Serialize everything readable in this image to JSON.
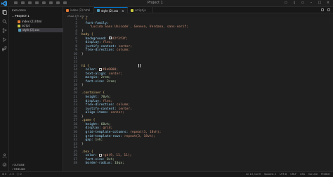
{
  "window": {
    "title": "Project 1"
  },
  "menu_count": 8,
  "sidebar": {
    "header": "EXPLORER",
    "project_label": "PROJECT 1",
    "files": [
      {
        "name": "index (2).html",
        "color": "#e37933"
      },
      {
        "name": "script",
        "color": "#cbcb41"
      },
      {
        "name": "style (2).css",
        "color": "#519aba"
      }
    ],
    "outline_label": "OUTLINE",
    "timeline_label": "TIMELINE"
  },
  "tabs": [
    {
      "label": "index (2).html",
      "color": "#e37933"
    },
    {
      "label": "style (2).css",
      "color": "#519aba",
      "active": true
    },
    {
      "label": "script.js",
      "color": "#cbcb41"
    }
  ],
  "breadcrumb": "style (2).css > ...",
  "code_lines": [
    {
      "n": "1",
      "parts": [
        {
          "t": "* {",
          "c": "sel"
        }
      ]
    },
    {
      "n": "2",
      "parts": [
        {
          "t": "  font-family: ",
          "c": "prop"
        }
      ]
    },
    {
      "n": "3",
      "parts": [
        {
          "t": "    'Lucida Sans Unicode', Geneva, Verdana, sans-serif;",
          "c": "val"
        }
      ]
    },
    {
      "n": "4",
      "parts": [
        {
          "t": "}",
          "c": "punc"
        }
      ]
    },
    {
      "n": "5",
      "parts": [
        {
          "t": "body {",
          "c": "sel"
        }
      ]
    },
    {
      "n": "6",
      "parts": [
        {
          "t": "  background: ",
          "c": "prop"
        },
        {
          "t": "#2f3f3f;",
          "c": "val",
          "swatch": "#2f3f3f"
        }
      ]
    },
    {
      "n": "7",
      "parts": [
        {
          "t": "  display: ",
          "c": "prop"
        },
        {
          "t": "flex;",
          "c": "val"
        }
      ]
    },
    {
      "n": "8",
      "parts": [
        {
          "t": "  justify-content: ",
          "c": "prop"
        },
        {
          "t": "center;",
          "c": "val"
        }
      ]
    },
    {
      "n": "9",
      "parts": [
        {
          "t": "  flex-direction: ",
          "c": "prop"
        },
        {
          "t": "column;",
          "c": "val"
        }
      ]
    },
    {
      "n": "10",
      "parts": [
        {
          "t": "}",
          "c": "punc"
        }
      ]
    },
    {
      "n": "11",
      "parts": []
    },
    {
      "n": "12",
      "parts": []
    },
    {
      "n": "13",
      "parts": [
        {
          "t": "h1 {",
          "c": "sel"
        }
      ]
    },
    {
      "n": "14",
      "parts": [
        {
          "t": "  color: ",
          "c": "prop"
        },
        {
          "t": "#0a0000;",
          "c": "val",
          "swatch": "#0a0000"
        }
      ]
    },
    {
      "n": "15",
      "parts": [
        {
          "t": "  text-align: ",
          "c": "prop"
        },
        {
          "t": "center;",
          "c": "val"
        }
      ]
    },
    {
      "n": "16",
      "parts": [
        {
          "t": "  margin: ",
          "c": "prop"
        },
        {
          "t": "2rem;",
          "c": "num"
        }
      ]
    },
    {
      "n": "17",
      "parts": [
        {
          "t": "  font-size: ",
          "c": "prop"
        },
        {
          "t": "3rem;",
          "c": "num"
        }
      ]
    },
    {
      "n": "18",
      "parts": [
        {
          "t": "}",
          "c": "punc"
        }
      ]
    },
    {
      "n": "19",
      "parts": []
    },
    {
      "n": "20",
      "parts": [
        {
          "t": ".container {",
          "c": "sel"
        }
      ]
    },
    {
      "n": "21",
      "parts": [
        {
          "t": "  height: ",
          "c": "prop"
        },
        {
          "t": "70vh;",
          "c": "num"
        }
      ]
    },
    {
      "n": "22",
      "parts": [
        {
          "t": "  display: ",
          "c": "prop"
        },
        {
          "t": "flex;",
          "c": "val"
        }
      ]
    },
    {
      "n": "23",
      "parts": [
        {
          "t": "  flex-direction: ",
          "c": "prop"
        },
        {
          "t": "column;",
          "c": "val"
        }
      ]
    },
    {
      "n": "24",
      "parts": [
        {
          "t": "  justify-content: ",
          "c": "prop"
        },
        {
          "t": "center;",
          "c": "val"
        }
      ]
    },
    {
      "n": "25",
      "parts": [
        {
          "t": "  align-items: ",
          "c": "prop"
        },
        {
          "t": "center;",
          "c": "val"
        }
      ]
    },
    {
      "n": "26",
      "parts": [
        {
          "t": "}",
          "c": "punc"
        }
      ]
    },
    {
      "n": "27",
      "parts": [
        {
          "t": ".game {",
          "c": "sel"
        }
      ]
    },
    {
      "n": "28",
      "parts": [
        {
          "t": "  height: ",
          "c": "prop"
        },
        {
          "t": "60vh;",
          "c": "num"
        }
      ]
    },
    {
      "n": "29",
      "parts": [
        {
          "t": "  display: ",
          "c": "prop"
        },
        {
          "t": "grid;",
          "c": "val"
        }
      ]
    },
    {
      "n": "30",
      "parts": [
        {
          "t": "  grid-template-columns: ",
          "c": "prop"
        },
        {
          "t": "repeat(3, 18vh);",
          "c": "val"
        }
      ]
    },
    {
      "n": "31",
      "parts": [
        {
          "t": "  grid-template-rows: ",
          "c": "prop"
        },
        {
          "t": "repeat(3, 18vh);",
          "c": "val"
        }
      ]
    },
    {
      "n": "32",
      "parts": [
        {
          "t": "  gap: ",
          "c": "prop"
        },
        {
          "t": "1vh;",
          "c": "num"
        }
      ]
    },
    {
      "n": "33",
      "parts": [
        {
          "t": "}",
          "c": "punc"
        }
      ]
    },
    {
      "n": "34",
      "parts": []
    },
    {
      "n": "35",
      "parts": [
        {
          "t": ".box {",
          "c": "sel"
        }
      ]
    },
    {
      "n": "36",
      "parts": [
        {
          "t": "  color: ",
          "c": "prop"
        },
        {
          "t": "rgb(9, 11, 11);",
          "c": "val",
          "swatch": "#090b0b"
        }
      ]
    },
    {
      "n": "37",
      "parts": [
        {
          "t": "  font-size: ",
          "c": "prop"
        },
        {
          "t": "8vh;",
          "c": "num"
        }
      ]
    },
    {
      "n": "38",
      "parts": [
        {
          "t": "  border-radius: ",
          "c": "prop"
        },
        {
          "t": "10px;",
          "c": "num"
        }
      ]
    }
  ],
  "status": {
    "left": [
      "⊗ 0",
      "⚠ 0",
      "ⓘ 0"
    ],
    "right": [
      "Ln 13, Col 5",
      "Spaces: 2",
      "UTF-8",
      "CRLF",
      "CSS",
      "Go Live",
      "Prettier"
    ]
  }
}
